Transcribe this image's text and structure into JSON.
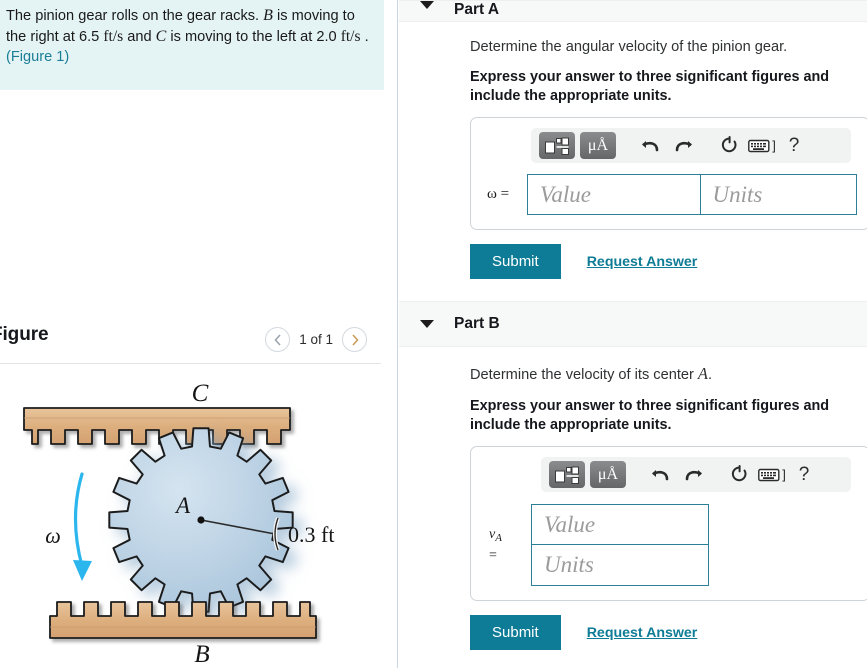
{
  "problem": {
    "sentence_1": "The pinion gear rolls on the gear racks. ",
    "label_B": "B",
    "sentence_2": " is moving to the right at 6.5 ",
    "unit_1": "ft/s",
    "sentence_3": " and ",
    "label_C": "C",
    "sentence_4": " is moving to the left at 2.0 ",
    "unit_2": "ft/s",
    "sentence_5": " .",
    "figure_link": "(Figure 1)"
  },
  "figure_panel": {
    "title": "Figure",
    "prev_icon": "chevron-left-icon",
    "next_icon": "chevron-right-icon",
    "counter": "1 of 1",
    "diagram": {
      "label_top_rack": "C",
      "label_bottom_rack": "B",
      "label_center": "A",
      "label_omega": "ω",
      "label_radius": "0.3 ft",
      "gear_teeth": 16,
      "colors": {
        "rack_fill": "#dfb183",
        "gear_fill": "#b6cde1",
        "outline": "#1a1a1a",
        "arrow": "#2bb6ee"
      }
    }
  },
  "toolbar": {
    "template_icon": "math-template-icon",
    "units_icon": "units-micro-angstrom-icon",
    "units_label": "μÅ",
    "undo_icon": "undo-icon",
    "redo_icon": "redo-icon",
    "reset_icon": "reset-icon",
    "keyboard_icon": "keyboard-icon",
    "keyboard_bracket": "]",
    "help_icon": "help-icon",
    "help_label": "?"
  },
  "part_a": {
    "caret_icon": "caret-down-icon",
    "title": "Part A",
    "prompt": "Determine the angular velocity of the pinion gear.",
    "instruction": "Express your answer to three significant figures and include the appropriate units.",
    "var_symbol": "ω",
    "var_equals": "=",
    "value_placeholder": "Value",
    "units_placeholder": "Units",
    "value_current": "",
    "units_current": "",
    "submit_label": "Submit",
    "request_label": "Request Answer"
  },
  "part_b": {
    "caret_icon": "caret-down-icon",
    "title": "Part B",
    "prompt_prefix": "Determine the velocity of its center ",
    "prompt_var": "A",
    "prompt_suffix": ".",
    "instruction": "Express your answer to three significant figures and include the appropriate units.",
    "var_symbol": "v",
    "var_subscript": "A",
    "var_equals": "=",
    "value_placeholder": "Value",
    "units_placeholder": "Units",
    "value_current": "",
    "units_current": "",
    "submit_label": "Submit",
    "request_label": "Request Answer"
  },
  "colors": {
    "accent_teal": "#0e7c96",
    "problem_bg": "#e4f3f4",
    "part_header_bg": "#f7f8f8",
    "input_border": "#2b7f96"
  }
}
